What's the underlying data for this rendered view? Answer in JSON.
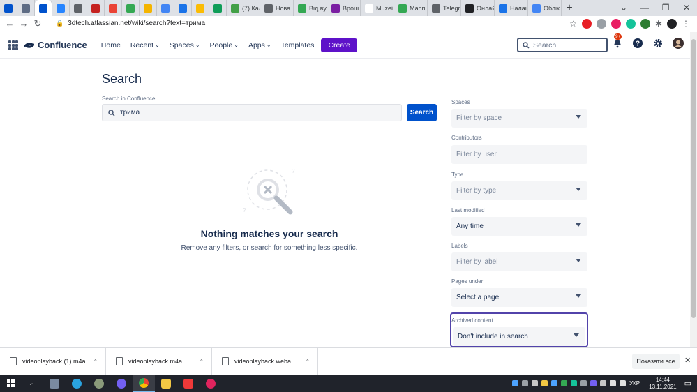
{
  "browser": {
    "tabs": [
      {
        "title": "",
        "color": "#0052cc"
      },
      {
        "title": "",
        "color": "#5e6c84"
      },
      {
        "title": "",
        "color": "#0052cc",
        "active": true
      },
      {
        "title": "",
        "color": "#2684ff"
      },
      {
        "title": "",
        "color": "#5f6368"
      },
      {
        "title": "",
        "color": "#c5221f"
      },
      {
        "title": "",
        "color": "#ea4335"
      },
      {
        "title": "",
        "color": "#34a853"
      },
      {
        "title": "",
        "color": "#f4b400"
      },
      {
        "title": "",
        "color": "#4285f4"
      },
      {
        "title": "",
        "color": "#1a73e8"
      },
      {
        "title": "",
        "color": "#fbbc04"
      },
      {
        "title": "",
        "color": "#0f9d58"
      },
      {
        "title": "(7) Кал",
        "color": "#43a047"
      },
      {
        "title": "Нова",
        "color": "#5f6368"
      },
      {
        "title": "Від ву",
        "color": "#34a853"
      },
      {
        "title": "Врош",
        "color": "#7b1fa2"
      },
      {
        "title": "Muzei",
        "color": "#ffffff"
      },
      {
        "title": "Мапп",
        "color": "#34a853"
      },
      {
        "title": "Telegr",
        "color": "#5f6368"
      },
      {
        "title": "Онлай",
        "color": "#202124"
      },
      {
        "title": "Налаш",
        "color": "#1a73e8"
      },
      {
        "title": "Облік",
        "color": "#4285f4"
      }
    ],
    "url": "3dtech.atlassian.net/wiki/search?text=трима"
  },
  "header": {
    "product": "Confluence",
    "nav": [
      {
        "label": "Home",
        "dropdown": false
      },
      {
        "label": "Recent",
        "dropdown": true
      },
      {
        "label": "Spaces",
        "dropdown": true
      },
      {
        "label": "People",
        "dropdown": true
      },
      {
        "label": "Apps",
        "dropdown": true
      },
      {
        "label": "Templates",
        "dropdown": false
      }
    ],
    "create_label": "Create",
    "search_placeholder": "Search",
    "notif_badge": "9+"
  },
  "main": {
    "title": "Search",
    "search_label": "Search in Confluence",
    "search_value": "трима",
    "search_button": "Search",
    "empty_title": "Nothing matches your search",
    "empty_subtitle": "Remove any filters, or search for something less specific."
  },
  "filters": [
    {
      "label": "Spaces",
      "value": "Filter by space",
      "dropdown": true,
      "placeholder": true
    },
    {
      "label": "Contributors",
      "value": "Filter by user",
      "dropdown": false,
      "placeholder": true
    },
    {
      "label": "Type",
      "value": "Filter by type",
      "dropdown": true,
      "placeholder": true
    },
    {
      "label": "Last modified",
      "value": "Any time",
      "dropdown": true,
      "placeholder": false
    },
    {
      "label": "Labels",
      "value": "Filter by label",
      "dropdown": true,
      "placeholder": true
    },
    {
      "label": "Pages under",
      "value": "Select a page",
      "dropdown": true,
      "placeholder": false
    },
    {
      "label": "Archived content",
      "value": "Don't include in search",
      "dropdown": true,
      "placeholder": false
    }
  ],
  "downloads": {
    "items": [
      "videoplayback (1).m4a",
      "videoplayback.m4a",
      "videoplayback.weba"
    ],
    "show_all": "Показати все"
  },
  "taskbar": {
    "lang": "УКР",
    "time": "14:44",
    "date": "13.11.2021"
  }
}
